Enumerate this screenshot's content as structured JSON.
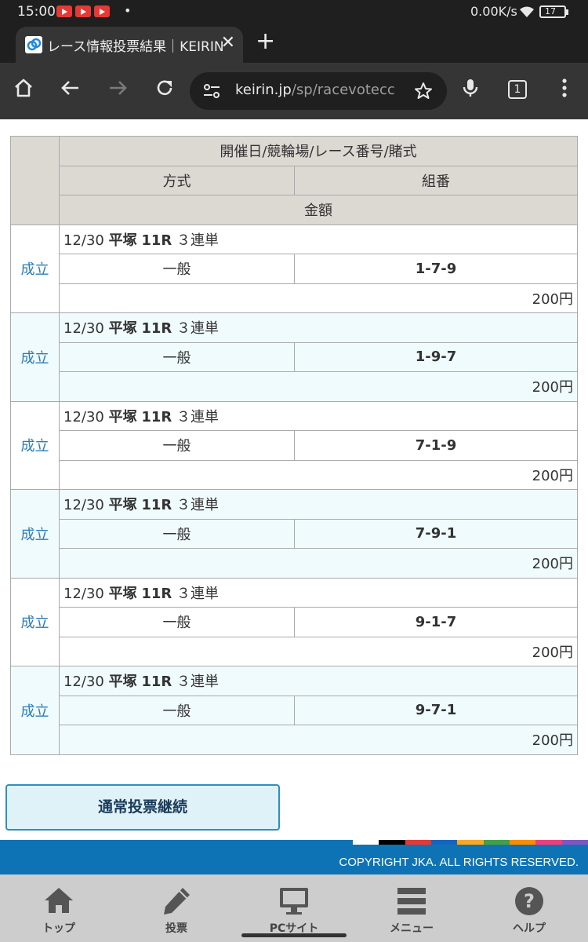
{
  "statusbar": {
    "time": "15:00",
    "dot": "•",
    "speed": "0.00K/s",
    "battery": "17"
  },
  "browser": {
    "tab_title": "レース情報投票結果｜KEIRIN",
    "url_domain": "keirin.jp",
    "url_path": "/sp/racevotecc",
    "tab_count": "1"
  },
  "table": {
    "header_row1": "開催日/競輪場/レース番号/賭式",
    "header_method": "方式",
    "header_combo": "組番",
    "header_amount": "金額",
    "rows": [
      {
        "status": "成立",
        "date": "12/30",
        "venue": "平塚",
        "race": "11R",
        "bet_type": "３連単",
        "method": "一般",
        "combo": "1-7-9",
        "amount": "200円"
      },
      {
        "status": "成立",
        "date": "12/30",
        "venue": "平塚",
        "race": "11R",
        "bet_type": "３連単",
        "method": "一般",
        "combo": "1-9-7",
        "amount": "200円"
      },
      {
        "status": "成立",
        "date": "12/30",
        "venue": "平塚",
        "race": "11R",
        "bet_type": "３連単",
        "method": "一般",
        "combo": "7-1-9",
        "amount": "200円"
      },
      {
        "status": "成立",
        "date": "12/30",
        "venue": "平塚",
        "race": "11R",
        "bet_type": "３連単",
        "method": "一般",
        "combo": "7-9-1",
        "amount": "200円"
      },
      {
        "status": "成立",
        "date": "12/30",
        "venue": "平塚",
        "race": "11R",
        "bet_type": "３連単",
        "method": "一般",
        "combo": "9-1-7",
        "amount": "200円"
      },
      {
        "status": "成立",
        "date": "12/30",
        "venue": "平塚",
        "race": "11R",
        "bet_type": "３連単",
        "method": "一般",
        "combo": "9-7-1",
        "amount": "200円"
      }
    ]
  },
  "continue_button": "通常投票継続",
  "footer": {
    "copyright": "COPYRIGHT JKA. ALL RIGHTS RESERVED.",
    "strip_colors": [
      "#ffffff",
      "#000000",
      "#e53935",
      "#1565c0",
      "#f9a825",
      "#43a047",
      "#fb8c00",
      "#ec407a",
      "#7e57c2"
    ]
  },
  "nav": [
    {
      "label": "トップ",
      "icon": "home-icon"
    },
    {
      "label": "投票",
      "icon": "pencil-icon"
    },
    {
      "label": "PCサイト",
      "icon": "monitor-icon"
    },
    {
      "label": "メニュー",
      "icon": "menu-icon"
    },
    {
      "label": "ヘルプ",
      "icon": "help-icon"
    }
  ],
  "colors": {
    "accent": "#0e73b5",
    "status_link": "#2a7bb8",
    "header_bg": "#dcd9d3",
    "alt_row_bg": "#f0fbfd"
  }
}
